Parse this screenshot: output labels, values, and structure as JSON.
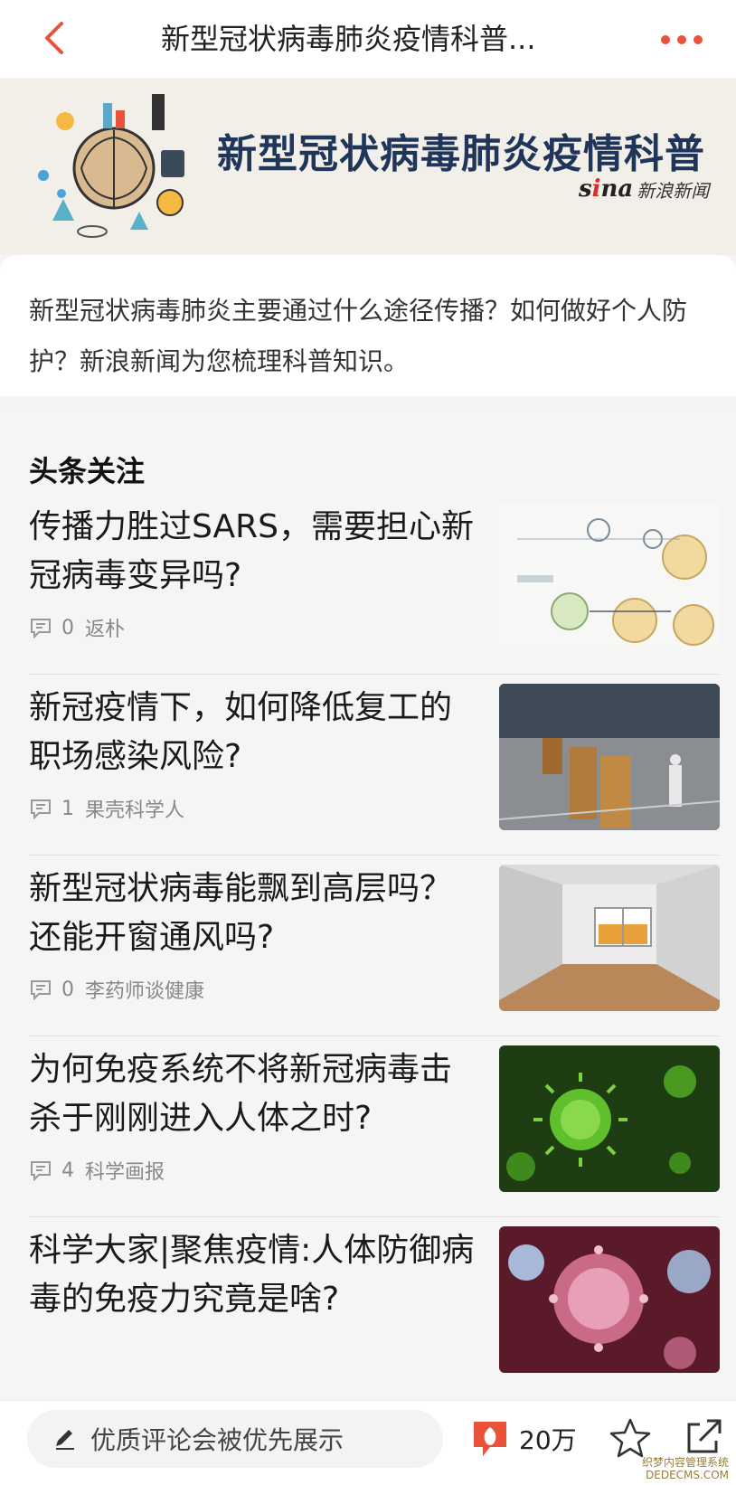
{
  "nav": {
    "title": "新型冠状病毒肺炎疫情科普...",
    "back_icon": "chevron-left-icon",
    "more_icon": "more-dots-icon",
    "accent": "#e8533a"
  },
  "banner": {
    "title": "新型冠状病毒肺炎疫情科普",
    "logo_mark": "sina",
    "logo_text": "新浪新闻"
  },
  "intro": {
    "text": "新型冠状病毒肺炎主要通过什么途径传播？如何做好个人防护？新浪新闻为您梳理科普知识。"
  },
  "section": {
    "heading": "头条关注",
    "items": [
      {
        "title": "传播力胜过SARS，需要担心新冠病毒变异吗?",
        "comments": "0",
        "source": "返朴",
        "thumb": "virus-diagram"
      },
      {
        "title": "新冠疫情下，如何降低复工的职场感染风险?",
        "comments": "1",
        "source": "果壳科学人",
        "thumb": "factory"
      },
      {
        "title": "新型冠状病毒能飘到高层吗？还能开窗通风吗?",
        "comments": "0",
        "source": "李药师谈健康",
        "thumb": "room-window"
      },
      {
        "title": "为何免疫系统不将新冠病毒击杀于刚刚进入人体之时?",
        "comments": "4",
        "source": "科学画报",
        "thumb": "green-virus"
      },
      {
        "title": "科学大家|聚焦疫情:人体防御病毒的免疫力究竟是啥?",
        "comments": "",
        "source": "",
        "thumb": "pink-virus"
      }
    ]
  },
  "toolbar": {
    "comment_placeholder": "优质评论会被优先展示",
    "comment_count": "20万",
    "pen_icon": "pencil-icon",
    "star_icon": "star-icon",
    "share_icon": "share-icon"
  },
  "watermark": {
    "line1": "织梦内容管理系统",
    "line2": "DEDECMS.COM"
  }
}
